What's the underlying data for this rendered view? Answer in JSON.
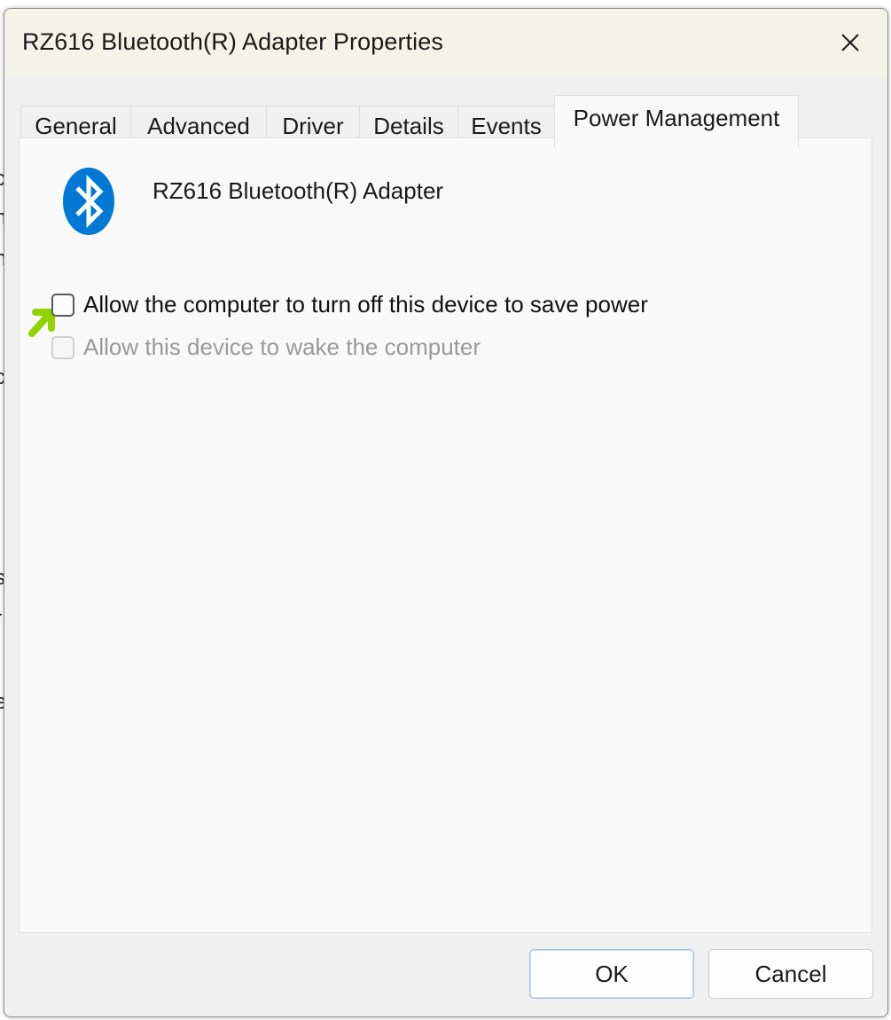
{
  "window": {
    "title": "RZ616 Bluetooth(R) Adapter Properties"
  },
  "tabs": [
    {
      "label": "General"
    },
    {
      "label": "Advanced"
    },
    {
      "label": "Driver"
    },
    {
      "label": "Details"
    },
    {
      "label": "Events"
    },
    {
      "label": "Power Management"
    }
  ],
  "active_tab": "Power Management",
  "device": {
    "name": "RZ616 Bluetooth(R) Adapter",
    "icon": "bluetooth-icon",
    "icon_color": "#0078d4"
  },
  "options": [
    {
      "label": "Allow the computer to turn off this device to save power",
      "checked": false,
      "enabled": true
    },
    {
      "label": "Allow this device to wake the computer",
      "checked": false,
      "enabled": false
    }
  ],
  "annotation": {
    "icon": "arrow-pointer-icon",
    "color": "#8fd400"
  },
  "buttons": {
    "ok": "OK",
    "cancel": "Cancel"
  }
}
